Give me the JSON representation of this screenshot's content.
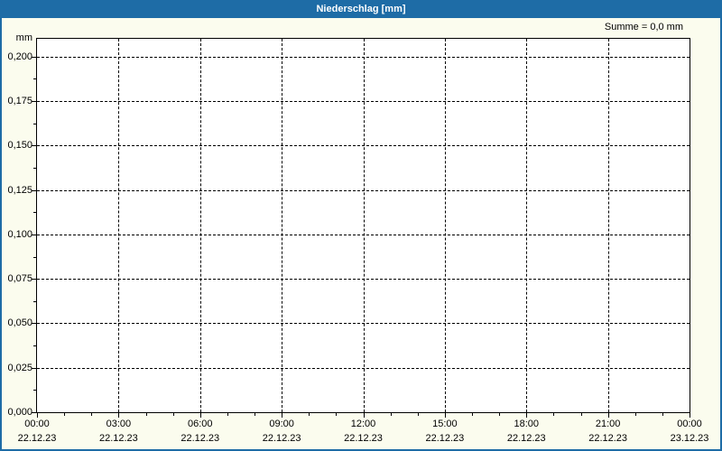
{
  "window": {
    "title": "Niederschlag [mm]"
  },
  "colors": {
    "titlebar": "#1E6CA6",
    "window_border": "#1E6CA6",
    "background": "#FBFCEE",
    "plot_background": "#FFFFFF",
    "grid": "#000000",
    "text": "#000000",
    "title_text": "#FFFFFF"
  },
  "chart_data": {
    "type": "line",
    "title": "Niederschlag [mm]",
    "sum_annotation": "Summe = 0,0 mm",
    "ylabel": "mm",
    "xlabel": "",
    "ylim": [
      0,
      0.21
    ],
    "xlim_hours": [
      0,
      24
    ],
    "grid": "dashed lines at every major tick, both axes",
    "legend": "none",
    "y_ticks": [
      {
        "value": 0.2,
        "label": "0,200"
      },
      {
        "value": 0.175,
        "label": "0,175"
      },
      {
        "value": 0.15,
        "label": "0,150"
      },
      {
        "value": 0.125,
        "label": "0,125"
      },
      {
        "value": 0.1,
        "label": "0,100"
      },
      {
        "value": 0.075,
        "label": "0,075"
      },
      {
        "value": 0.05,
        "label": "0,050"
      },
      {
        "value": 0.025,
        "label": "0,025"
      },
      {
        "value": 0.0,
        "label": "0,000"
      }
    ],
    "y_minor_step": 0.0125,
    "x_ticks": [
      {
        "hour": 0,
        "time": "00:00",
        "date": "22.12.23"
      },
      {
        "hour": 3,
        "time": "03:00",
        "date": "22.12.23"
      },
      {
        "hour": 6,
        "time": "06:00",
        "date": "22.12.23"
      },
      {
        "hour": 9,
        "time": "09:00",
        "date": "22.12.23"
      },
      {
        "hour": 12,
        "time": "12:00",
        "date": "22.12.23"
      },
      {
        "hour": 15,
        "time": "15:00",
        "date": "22.12.23"
      },
      {
        "hour": 18,
        "time": "18:00",
        "date": "22.12.23"
      },
      {
        "hour": 21,
        "time": "21:00",
        "date": "22.12.23"
      },
      {
        "hour": 24,
        "time": "00:00",
        "date": "23.12.23"
      }
    ],
    "x_minor_step_hours": 1,
    "series": [
      {
        "name": "Niederschlag",
        "unit": "mm",
        "points": [],
        "sum_mm": "0,0"
      }
    ]
  }
}
